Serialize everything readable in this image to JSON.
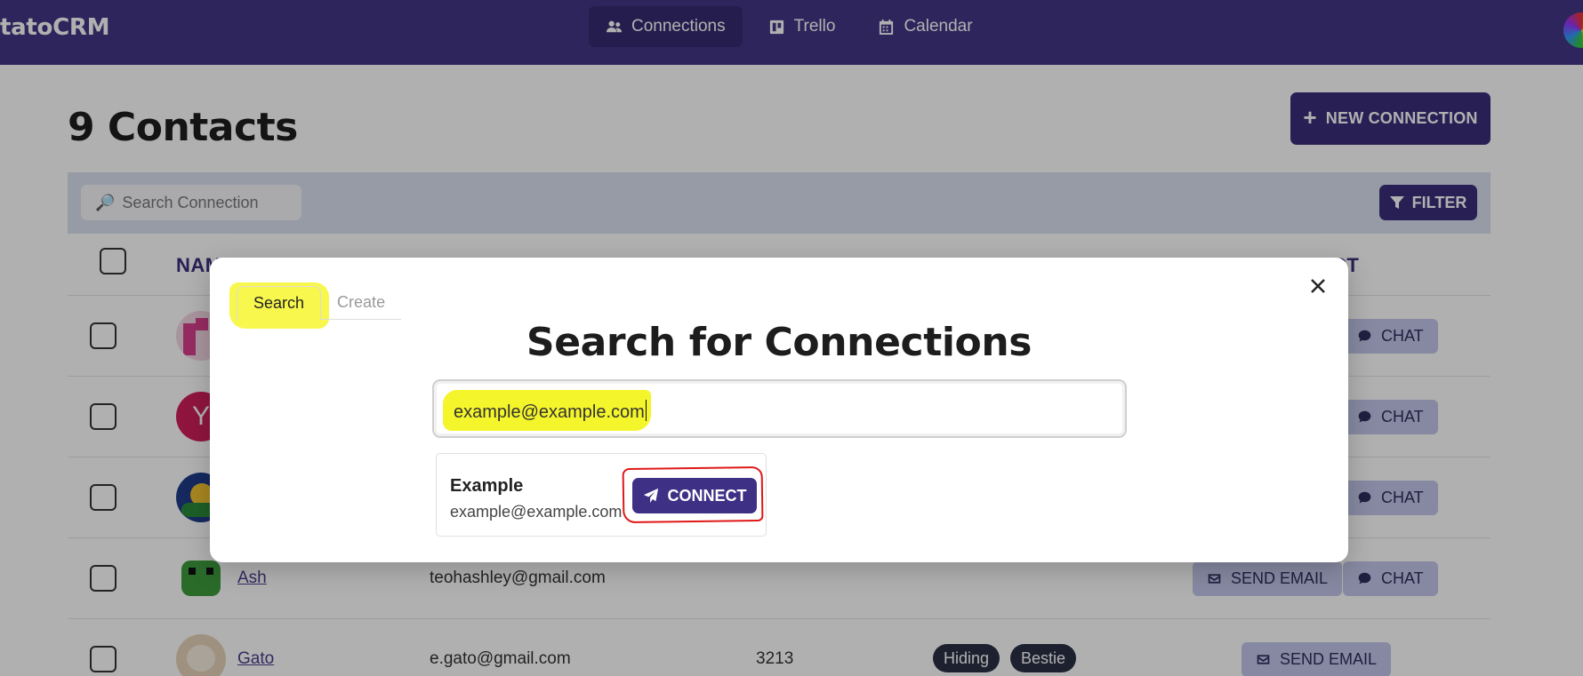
{
  "app": {
    "brand": "tatoCRM"
  },
  "nav": [
    {
      "label": "Connections",
      "icon": "users-icon",
      "active": true
    },
    {
      "label": "Trello",
      "icon": "trello-icon",
      "active": false
    },
    {
      "label": "Calendar",
      "icon": "calendar-icon",
      "active": false
    }
  ],
  "page": {
    "title": "9 Contacts",
    "new_connection_label": "NEW CONNECTION",
    "search_placeholder": "Search Connection",
    "filter_label": "FILTER",
    "columns": {
      "name": "NAM",
      "actions": "CT"
    }
  },
  "rows": [
    {
      "name": "",
      "email": "",
      "phone": "",
      "tags": [],
      "send_email": "",
      "chat": "CHAT"
    },
    {
      "name": "",
      "email": "",
      "phone": "",
      "tags": [],
      "send_email": "",
      "chat": "CHAT"
    },
    {
      "name": "",
      "email": "",
      "phone": "",
      "tags": [],
      "send_email": "",
      "chat": "CHAT"
    },
    {
      "name": "Ash",
      "email": "teohashley@gmail.com",
      "phone": "",
      "tags": [],
      "send_email": "SEND EMAIL",
      "chat": "CHAT"
    },
    {
      "name": "Gato",
      "email": "e.gato@gmail.com",
      "phone": "3213",
      "tags": [
        "Hiding",
        "Bestie"
      ],
      "send_email": "SEND EMAIL",
      "chat": ""
    }
  ],
  "modal": {
    "tabs": [
      {
        "label": "Search",
        "active": true
      },
      {
        "label": "Create",
        "active": false
      }
    ],
    "title": "Search for Connections",
    "search_value": "example@example.com",
    "result": {
      "name": "Example",
      "email": "example@example.com",
      "connect_label": "CONNECT"
    }
  },
  "colors": {
    "primary": "#443687",
    "button": "#3a2e7c",
    "highlight": "#f5f52b",
    "annotation_ring": "#e01818"
  }
}
